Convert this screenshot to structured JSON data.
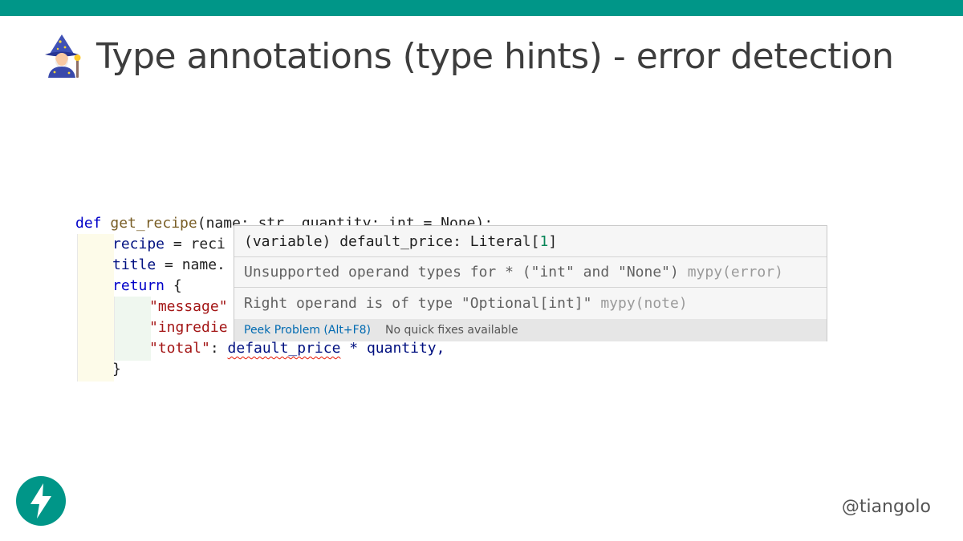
{
  "slide": {
    "title": "Type annotations (type hints) - error detection",
    "icon": "mage-emoji-icon",
    "accent_color": "#009688",
    "handle": "@tiangolo"
  },
  "code": {
    "line1": {
      "kw": "def",
      "fn": "get_recipe",
      "rest": "(name: str, quantity: int = None):"
    },
    "line2": {
      "var": "recipe",
      "rest": " = reci"
    },
    "line3": {
      "var": "title",
      "rest": " = name."
    },
    "line4": {
      "kw": "return",
      "rest": " {"
    },
    "line5": {
      "str": "\"message\""
    },
    "line6": {
      "str": "\"ingredie"
    },
    "line7": {
      "str": "\"total\"",
      "colon": ": ",
      "squiggle": "default_price",
      "rest": " * quantity,"
    },
    "line8": {
      "rest": "}"
    }
  },
  "hover": {
    "signature_prefix": "(variable) default_price: Literal[",
    "signature_value": "1",
    "signature_suffix": "]",
    "error_message": "Unsupported operand types for * (\"int\" and \"None\")",
    "error_source": "mypy(error)",
    "note_message": "Right operand is of type \"Optional[int]\"",
    "note_source": "mypy(note)",
    "peek_label": "Peek Problem (Alt+F8)",
    "no_fix_label": "No quick fixes available"
  }
}
